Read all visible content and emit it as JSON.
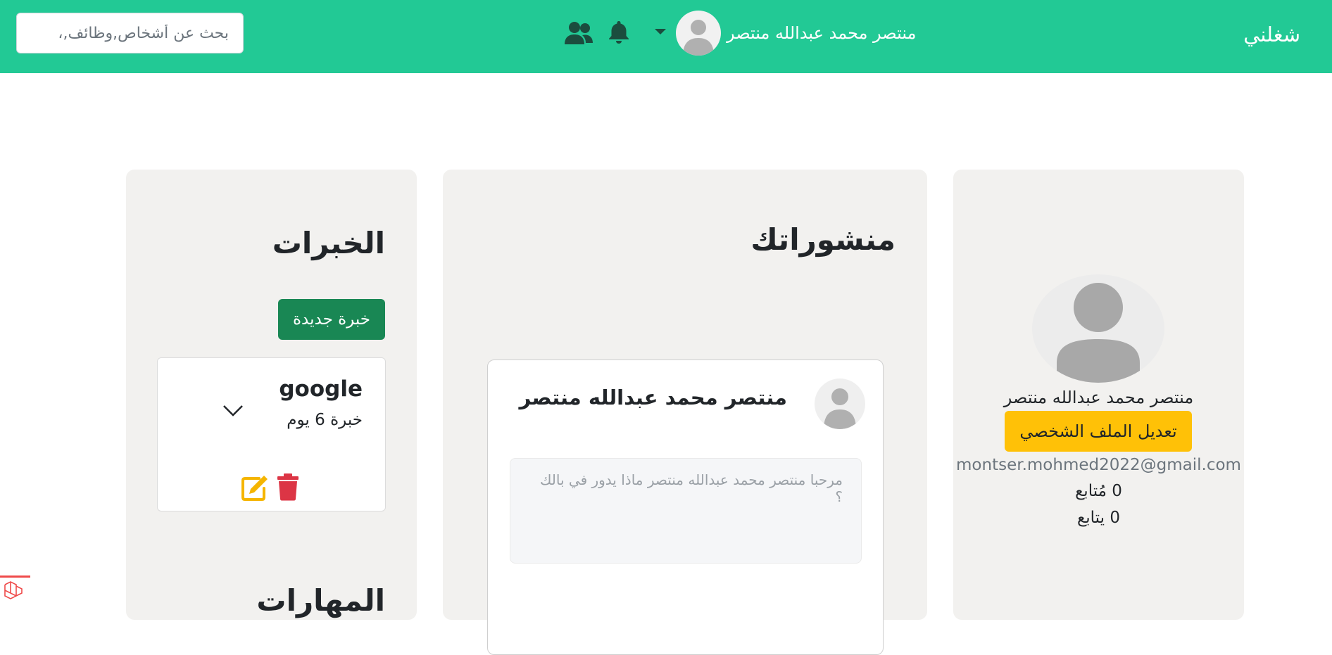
{
  "navbar": {
    "brand": "شغلني",
    "user_name": "منتصر محمد عبدالله منتصر",
    "search_placeholder": "بحث عن أشخاص,وظائف,،",
    "bg_color": "#22c995",
    "icons": [
      "people-icon",
      "bell-icon",
      "caret-down-icon"
    ]
  },
  "experiences": {
    "title": "الخبرات",
    "new_button": "خبرة جديدة",
    "items": [
      {
        "company": "google",
        "duration": "خبرة 6 يوم"
      }
    ],
    "next_section_title": "المهارات"
  },
  "posts": {
    "title": "منشوراتك",
    "composer": {
      "user_name": "منتصر محمد عبدالله منتصر",
      "placeholder": "مرحبا منتصر محمد عبدالله منتصر ماذا يدور في بالك ؟"
    }
  },
  "profile": {
    "name": "منتصر محمد عبدالله منتصر",
    "edit_button": "تعديل الملف الشخصي",
    "email": "montser.mohmed2022@gmail.com",
    "followers": "0 مُتابع",
    "following": "0 يتابع"
  }
}
